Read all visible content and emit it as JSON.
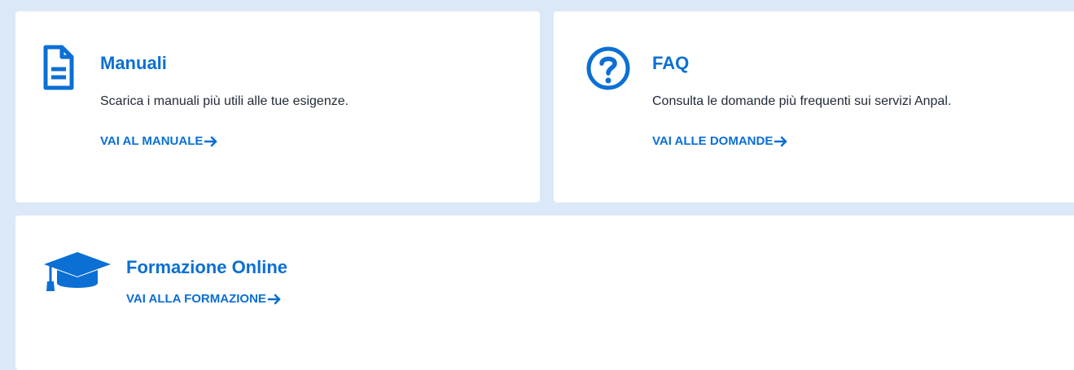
{
  "cards": {
    "manuali": {
      "icon": "document-icon",
      "title": "Manuali",
      "description": "Scarica i manuali più utili alle tue esigenze.",
      "link_label": "VAI AL MANUALE"
    },
    "faq": {
      "icon": "question-circle-icon",
      "title": "FAQ",
      "description": "Consulta le domande più frequenti sui servizi Anpal.",
      "link_label": "VAI ALLE DOMANDE"
    },
    "formazione": {
      "icon": "graduation-cap-icon",
      "title": "Formazione Online",
      "link_label": "VAI ALLA FORMAZIONE"
    }
  },
  "colors": {
    "accent": "#0b6fd3",
    "background": "#dbe8f8",
    "card": "#ffffff",
    "text": "#1f2a37"
  }
}
